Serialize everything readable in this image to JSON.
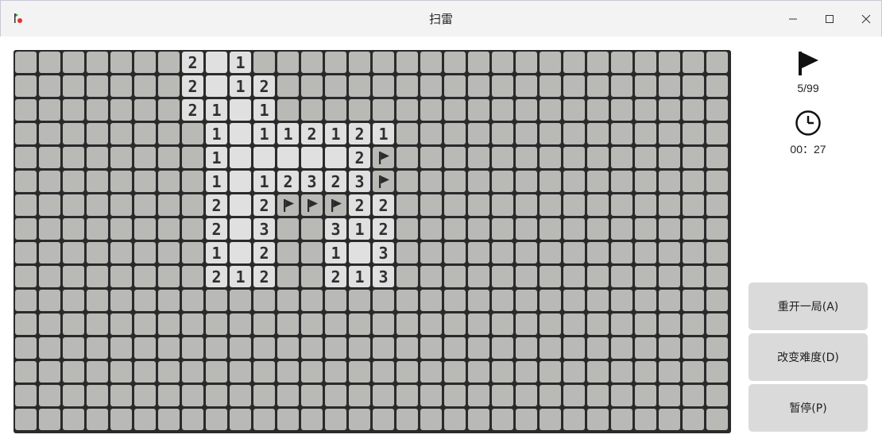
{
  "window": {
    "title": "扫雷",
    "controls": [
      "minimize",
      "maximize",
      "close"
    ]
  },
  "board": {
    "rows": 16,
    "cols": 30,
    "cells": [
      [
        "H",
        "H",
        "H",
        "H",
        "H",
        "H",
        "H",
        "2",
        "0",
        "1",
        "H",
        "H",
        "H",
        "H",
        "H",
        "H",
        "H",
        "H",
        "H",
        "H",
        "H",
        "H",
        "H",
        "H",
        "H",
        "H",
        "H",
        "H",
        "H",
        "H"
      ],
      [
        "H",
        "H",
        "H",
        "H",
        "H",
        "H",
        "H",
        "2",
        "0",
        "1",
        "2",
        "H",
        "H",
        "H",
        "H",
        "H",
        "H",
        "H",
        "H",
        "H",
        "H",
        "H",
        "H",
        "H",
        "H",
        "H",
        "H",
        "H",
        "H",
        "H"
      ],
      [
        "H",
        "H",
        "H",
        "H",
        "H",
        "H",
        "H",
        "2",
        "1",
        "0",
        "1",
        "H",
        "H",
        "H",
        "H",
        "H",
        "H",
        "H",
        "H",
        "H",
        "H",
        "H",
        "H",
        "H",
        "H",
        "H",
        "H",
        "H",
        "H",
        "H"
      ],
      [
        "H",
        "H",
        "H",
        "H",
        "H",
        "H",
        "H",
        "H",
        "1",
        "0",
        "1",
        "1",
        "2",
        "1",
        "2",
        "1",
        "H",
        "H",
        "H",
        "H",
        "H",
        "H",
        "H",
        "H",
        "H",
        "H",
        "H",
        "H",
        "H",
        "H"
      ],
      [
        "H",
        "H",
        "H",
        "H",
        "H",
        "H",
        "H",
        "H",
        "1",
        "0",
        "0",
        "0",
        "0",
        "0",
        "2",
        "F",
        "H",
        "H",
        "H",
        "H",
        "H",
        "H",
        "H",
        "H",
        "H",
        "H",
        "H",
        "H",
        "H",
        "H"
      ],
      [
        "H",
        "H",
        "H",
        "H",
        "H",
        "H",
        "H",
        "H",
        "1",
        "0",
        "1",
        "2",
        "3",
        "2",
        "3",
        "F",
        "H",
        "H",
        "H",
        "H",
        "H",
        "H",
        "H",
        "H",
        "H",
        "H",
        "H",
        "H",
        "H",
        "H"
      ],
      [
        "H",
        "H",
        "H",
        "H",
        "H",
        "H",
        "H",
        "H",
        "2",
        "0",
        "2",
        "F",
        "F",
        "F",
        "2",
        "2",
        "H",
        "H",
        "H",
        "H",
        "H",
        "H",
        "H",
        "H",
        "H",
        "H",
        "H",
        "H",
        "H",
        "H"
      ],
      [
        "H",
        "H",
        "H",
        "H",
        "H",
        "H",
        "H",
        "H",
        "2",
        "0",
        "3",
        "H",
        "H",
        "3",
        "1",
        "2",
        "H",
        "H",
        "H",
        "H",
        "H",
        "H",
        "H",
        "H",
        "H",
        "H",
        "H",
        "H",
        "H",
        "H"
      ],
      [
        "H",
        "H",
        "H",
        "H",
        "H",
        "H",
        "H",
        "H",
        "1",
        "0",
        "2",
        "H",
        "H",
        "1",
        "0",
        "3",
        "H",
        "H",
        "H",
        "H",
        "H",
        "H",
        "H",
        "H",
        "H",
        "H",
        "H",
        "H",
        "H",
        "H"
      ],
      [
        "H",
        "H",
        "H",
        "H",
        "H",
        "H",
        "H",
        "H",
        "2",
        "1",
        "2",
        "H",
        "H",
        "2",
        "1",
        "3",
        "H",
        "H",
        "H",
        "H",
        "H",
        "H",
        "H",
        "H",
        "H",
        "H",
        "H",
        "H",
        "H",
        "H"
      ],
      [
        "H",
        "H",
        "H",
        "H",
        "H",
        "H",
        "H",
        "H",
        "H",
        "H",
        "H",
        "H",
        "H",
        "H",
        "H",
        "H",
        "H",
        "H",
        "H",
        "H",
        "H",
        "H",
        "H",
        "H",
        "H",
        "H",
        "H",
        "H",
        "H",
        "H"
      ],
      [
        "H",
        "H",
        "H",
        "H",
        "H",
        "H",
        "H",
        "H",
        "H",
        "H",
        "H",
        "H",
        "H",
        "H",
        "H",
        "H",
        "H",
        "H",
        "H",
        "H",
        "H",
        "H",
        "H",
        "H",
        "H",
        "H",
        "H",
        "H",
        "H",
        "H"
      ],
      [
        "H",
        "H",
        "H",
        "H",
        "H",
        "H",
        "H",
        "H",
        "H",
        "H",
        "H",
        "H",
        "H",
        "H",
        "H",
        "H",
        "H",
        "H",
        "H",
        "H",
        "H",
        "H",
        "H",
        "H",
        "H",
        "H",
        "H",
        "H",
        "H",
        "H"
      ],
      [
        "H",
        "H",
        "H",
        "H",
        "H",
        "H",
        "H",
        "H",
        "H",
        "H",
        "H",
        "H",
        "H",
        "H",
        "H",
        "H",
        "H",
        "H",
        "H",
        "H",
        "H",
        "H",
        "H",
        "H",
        "H",
        "H",
        "H",
        "H",
        "H",
        "H"
      ],
      [
        "H",
        "H",
        "H",
        "H",
        "H",
        "H",
        "H",
        "H",
        "H",
        "H",
        "H",
        "H",
        "H",
        "H",
        "H",
        "H",
        "H",
        "H",
        "H",
        "H",
        "H",
        "H",
        "H",
        "H",
        "H",
        "H",
        "H",
        "H",
        "H",
        "H"
      ],
      [
        "H",
        "H",
        "H",
        "H",
        "H",
        "H",
        "H",
        "H",
        "H",
        "H",
        "H",
        "H",
        "H",
        "H",
        "H",
        "H",
        "H",
        "H",
        "H",
        "H",
        "H",
        "H",
        "H",
        "H",
        "H",
        "H",
        "H",
        "H",
        "H",
        "H"
      ]
    ]
  },
  "status": {
    "flag_icon": "flag-icon",
    "flags_text": "5/99",
    "clock_icon": "clock-icon",
    "time_text": "00：27"
  },
  "buttons": {
    "restart": "重开一局(A)",
    "difficulty": "改变难度(D)",
    "pause": "暂停(P)"
  },
  "colors": {
    "hidden_cell": "#b9bab6",
    "open_cell": "#e0e0e0",
    "grid_line": "#2a2a2a",
    "button_bg": "#dadada"
  }
}
